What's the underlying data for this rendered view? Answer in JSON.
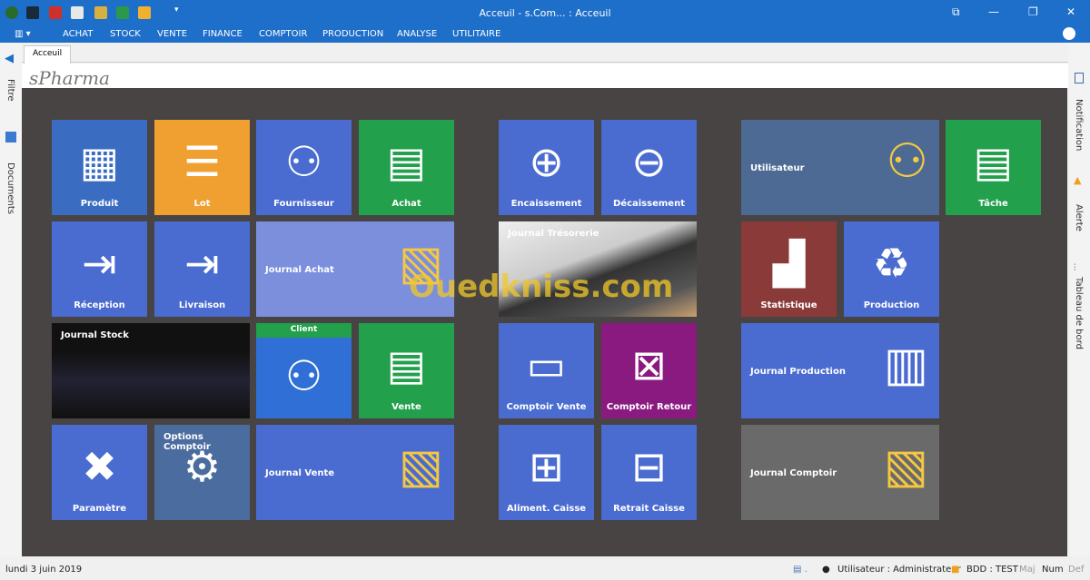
{
  "window": {
    "title": "Acceuil - s.Com... : Acceuil"
  },
  "quick_access": [
    "app-icon",
    "home-icon",
    "close-icon",
    "document-icon",
    "edit-icon",
    "grid-icon",
    "brush-icon",
    "customize-icon"
  ],
  "menu": [
    "ACHAT",
    "STOCK",
    "VENTE",
    "FINANCE",
    "COMPTOIR",
    "PRODUCTION",
    "ANALYSE",
    "UTILITAIRE"
  ],
  "left_panel": [
    "Filtre",
    "Documents"
  ],
  "right_panel": [
    "Notification",
    "Alerte",
    "Tableau de bord"
  ],
  "tab": "Acceuil",
  "brand": "sPharma",
  "tiles": [
    {
      "label": "Produit",
      "color": "#3a6dc2"
    },
    {
      "label": "Lot",
      "color": "#f0a030"
    },
    {
      "label": "Fournisseur",
      "color": "#4a6bd0"
    },
    {
      "label": "Achat",
      "color": "#22a04c"
    },
    {
      "label": "Réception",
      "color": "#4a6bd0"
    },
    {
      "label": "Livraison",
      "color": "#4a6bd0"
    },
    {
      "label": "Journal Achat",
      "color": "#7b8fdc"
    },
    {
      "label": "Journal Stock",
      "color": "#111111"
    },
    {
      "label": "Client",
      "color": "#2f6fd6"
    },
    {
      "label": "Vente",
      "color": "#22a04c"
    },
    {
      "label": "Paramètre",
      "color": "#4a6bd0"
    },
    {
      "label": "Options Comptoir",
      "color": "#4b6c9e"
    },
    {
      "label": "Journal Vente",
      "color": "#4a6bd0"
    },
    {
      "label": "Encaissement",
      "color": "#4a6bd0"
    },
    {
      "label": "Décaissement",
      "color": "#4a6bd0"
    },
    {
      "label": "Journal Trésorerie",
      "color": "#cfcfcf"
    },
    {
      "label": "Comptoir Vente",
      "color": "#4a6bd0"
    },
    {
      "label": "Comptoir Retour",
      "color": "#8a1a80"
    },
    {
      "label": "Aliment. Caisse",
      "color": "#4a6bd0"
    },
    {
      "label": "Retrait Caisse",
      "color": "#4a6bd0"
    },
    {
      "label": "Utilisateur",
      "color": "#4c6a94"
    },
    {
      "label": "Tâche",
      "color": "#22a04c"
    },
    {
      "label": "Statistique",
      "color": "#8b3a3a"
    },
    {
      "label": "Production",
      "color": "#4a6bd0"
    },
    {
      "label": "Journal Production",
      "color": "#4a6bd0"
    },
    {
      "label": "Journal Comptoir",
      "color": "#6a6a6a"
    }
  ],
  "watermark": "Ouedkniss.com",
  "status": {
    "date": "lundi 3 juin 2019",
    "user": "Utilisateur : Administrateur",
    "db": "BDD : TEST",
    "maj": "Maj",
    "num": "Num",
    "def": "Def"
  }
}
